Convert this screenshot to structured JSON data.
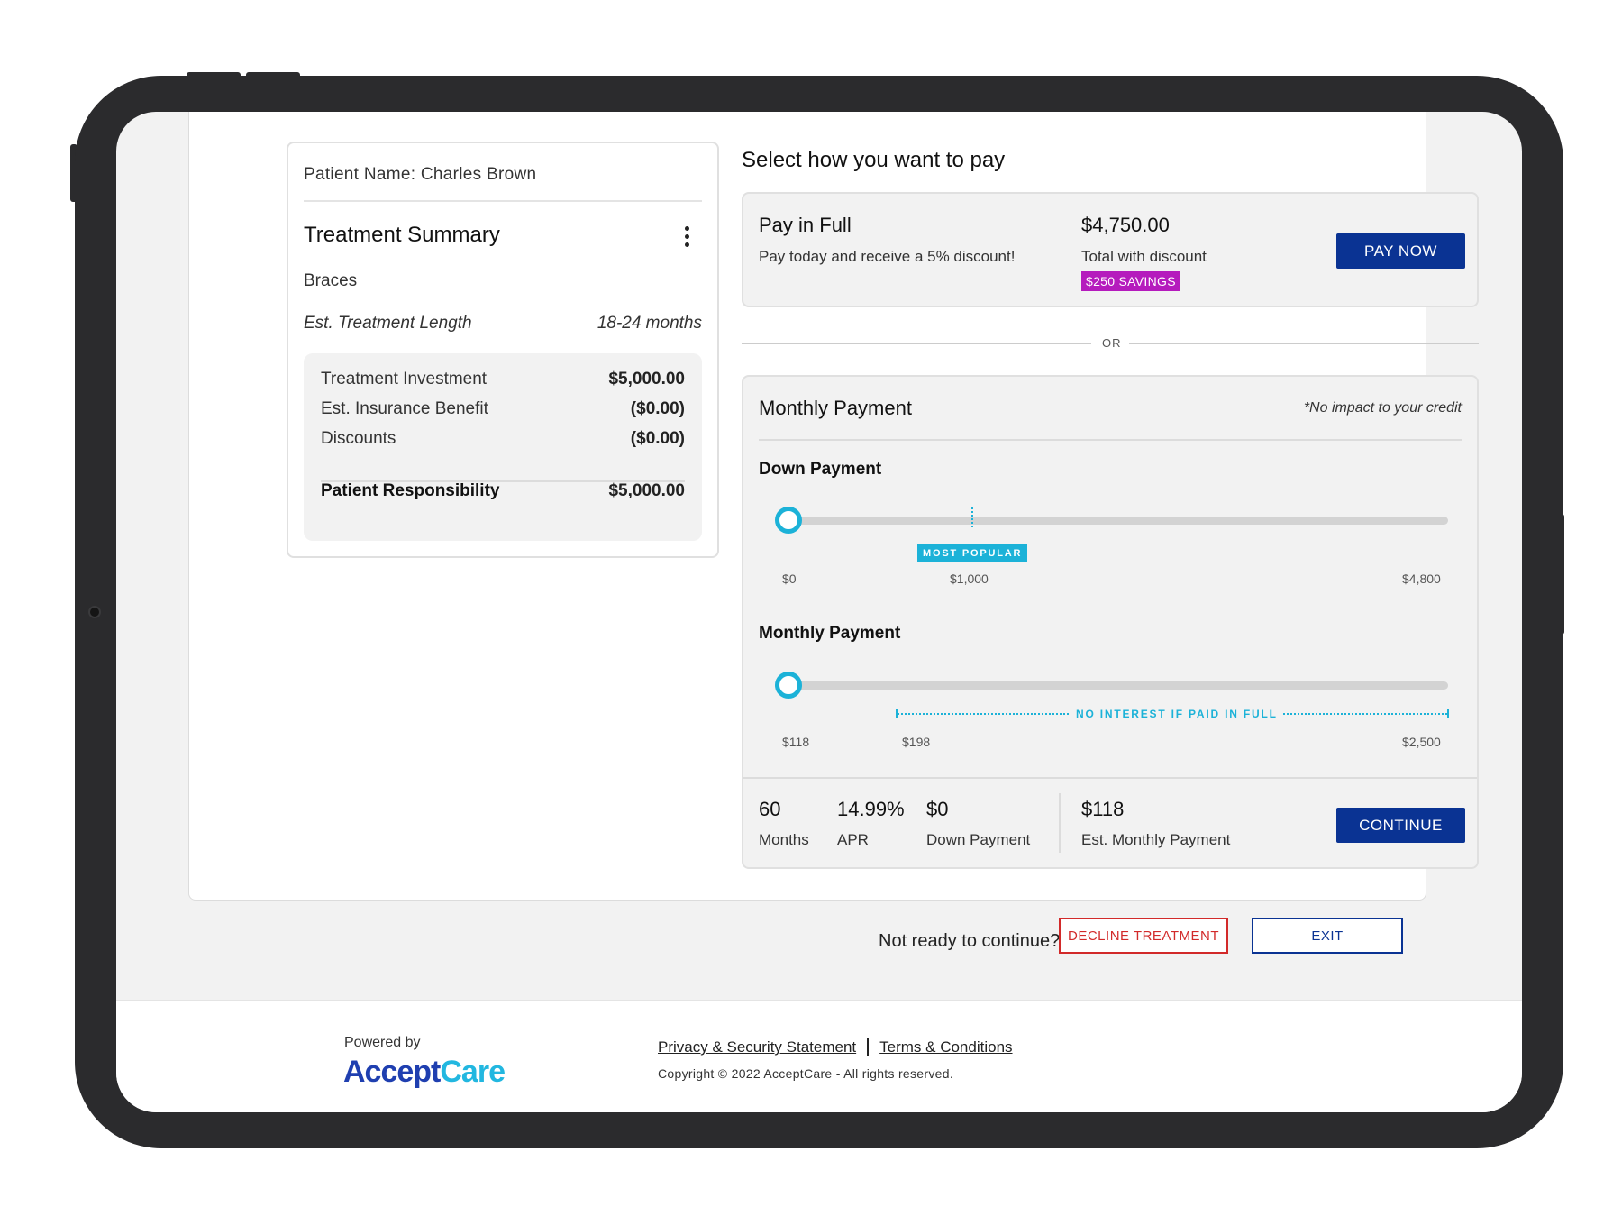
{
  "patient": {
    "name_label": "Patient Name: Charles Brown"
  },
  "treatment_summary": {
    "title": "Treatment Summary",
    "treatment": "Braces",
    "length_label": "Est. Treatment Length",
    "length_value": "18-24 months",
    "rows": [
      {
        "label": "Treatment Investment",
        "value": "$5,000.00"
      },
      {
        "label": "Est. Insurance Benefit",
        "value": "($0.00)"
      },
      {
        "label": "Discounts",
        "value": "($0.00)"
      }
    ],
    "total": {
      "label": "Patient Responsibility",
      "value": "$5,000.00"
    }
  },
  "payment": {
    "title": "Select how you want to pay",
    "pay_in_full": {
      "title": "Pay in Full",
      "subtitle": "Pay today and receive a 5% discount!",
      "amount": "$4,750.00",
      "amount_label": "Total with discount",
      "badge": "$250 SAVINGS",
      "button": "PAY NOW"
    },
    "or_label": "OR",
    "monthly": {
      "title": "Monthly Payment",
      "note": "*No impact to your credit",
      "down_payment": {
        "label": "Down Payment",
        "popular_badge": "MOST POPULAR",
        "min_label": "$0",
        "mid_label": "$1,000",
        "max_label": "$4,800",
        "value": 0
      },
      "monthly_payment": {
        "label": "Monthly Payment",
        "interest_note": "NO INTEREST IF PAID IN FULL",
        "min_label": "$118",
        "mid_label": "$198",
        "max_label": "$2,500",
        "value": 118
      },
      "summary": {
        "months_value": "60",
        "months_label": "Months",
        "apr_value": "14.99%",
        "apr_label": "APR",
        "down_value": "$0",
        "down_label": "Down Payment",
        "monthly_value": "$118",
        "monthly_label": "Est. Monthly Payment"
      },
      "button": "CONTINUE"
    }
  },
  "bottom": {
    "prompt": "Not ready to continue?",
    "decline_button": "DECLINE TREATMENT",
    "exit_button": "EXIT"
  },
  "footer": {
    "powered_by": "Powered by",
    "logo_part1": "Accept",
    "logo_part2": "Care",
    "privacy_link": "Privacy & Security Statement",
    "terms_link": "Terms & Conditions",
    "copyright": "Copyright © 2022 AcceptCare - All rights reserved."
  },
  "colors": {
    "primary": "#0a3393",
    "accent": "#1cb2d8",
    "savings_badge": "#b51bbd",
    "decline": "#d22a2a"
  }
}
